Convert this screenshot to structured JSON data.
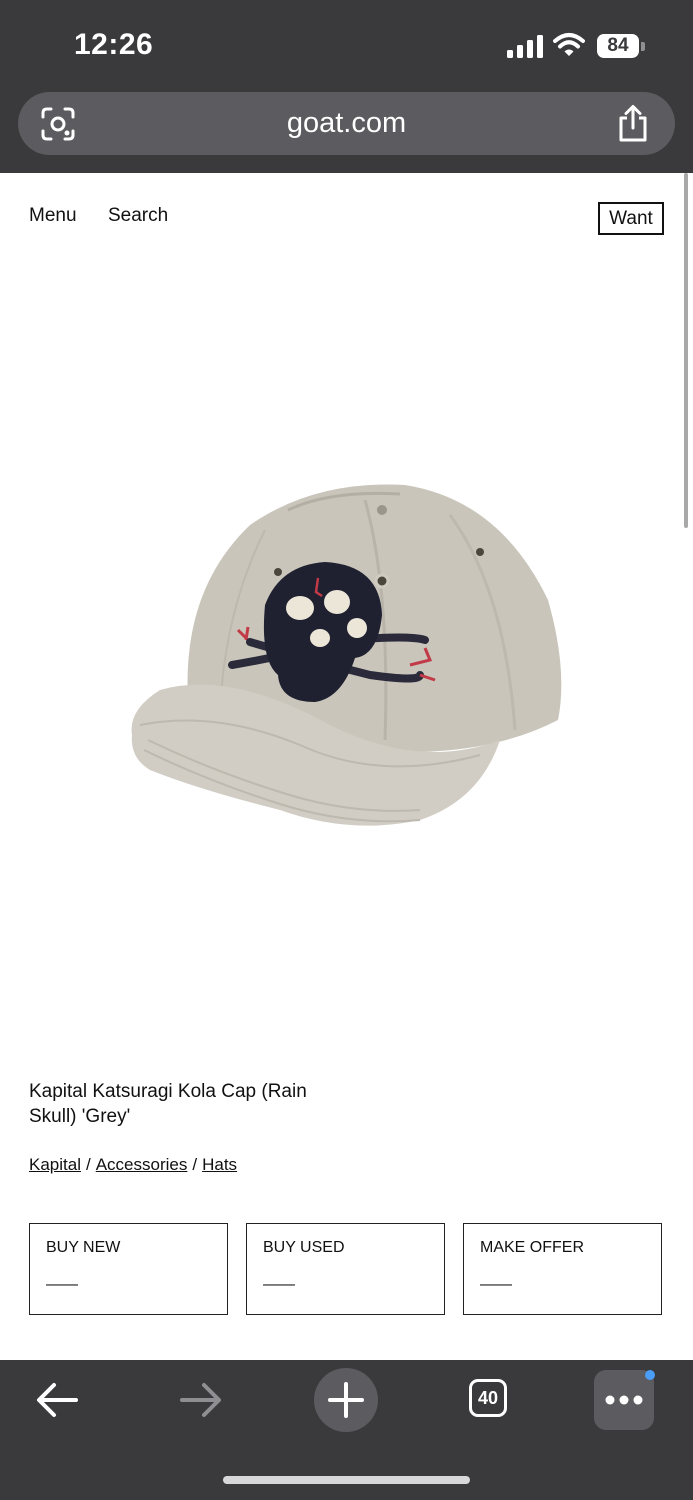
{
  "status_bar": {
    "time": "12:26",
    "battery": "84"
  },
  "browser": {
    "url": "goat.com",
    "tab_count": "40"
  },
  "nav": {
    "menu": "Menu",
    "search": "Search",
    "want": "Want"
  },
  "product": {
    "title": "Kapital Katsuragi Kola Cap (Rain Skull) 'Grey'",
    "image_icon": "cap-image",
    "breadcrumb": [
      "Kapital",
      "Accessories",
      "Hats"
    ],
    "breadcrumb_separator": "/"
  },
  "buy_options": [
    {
      "label": "BUY NEW",
      "price": "——"
    },
    {
      "label": "BUY USED",
      "price": "——"
    },
    {
      "label": "MAKE OFFER",
      "price": "——"
    }
  ],
  "colors": {
    "chrome": "#3a3a3c",
    "url_bar": "#5c5c60",
    "accent_dot": "#4a9ef7"
  }
}
